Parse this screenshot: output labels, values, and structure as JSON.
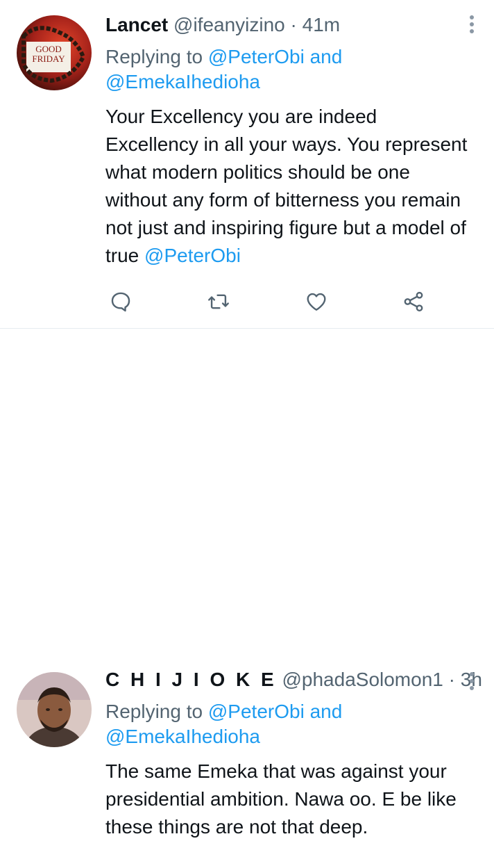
{
  "tweets": [
    {
      "name": "Lancet",
      "handle": "@ifeanyizino",
      "separator": "·",
      "time": "41m",
      "replying_prefix": "Replying to",
      "reply_to_1": "@PeterObi",
      "reply_and": "and",
      "reply_to_2": "@EmekaIhedioha",
      "text": "Your Excellency you are indeed Excellency in all your ways. You represent what modern politics should be one without any form of bitterness you remain not just and inspiring figure but a model of true",
      "text_mention": "@PeterObi",
      "avatar_text_line1": "GOOD",
      "avatar_text_line2": "FRIDAY"
    },
    {
      "name": "C H I J I O K E",
      "handle": "@phadaSolomon1",
      "separator": "·",
      "time": "3h",
      "replying_prefix": "Replying to",
      "reply_to_1": "@PeterObi",
      "reply_and": "and",
      "reply_to_2": "@EmekaIhedioha",
      "text": "The same Emeka that was against your presidential ambition. Nawa oo.  E be like these things are not that deep."
    }
  ],
  "colors": {
    "link": "#1d9bf0",
    "muted": "#536471",
    "text": "#0f1419"
  },
  "icons": [
    "reply-icon",
    "retweet-icon",
    "like-icon",
    "share-icon",
    "more-icon"
  ]
}
